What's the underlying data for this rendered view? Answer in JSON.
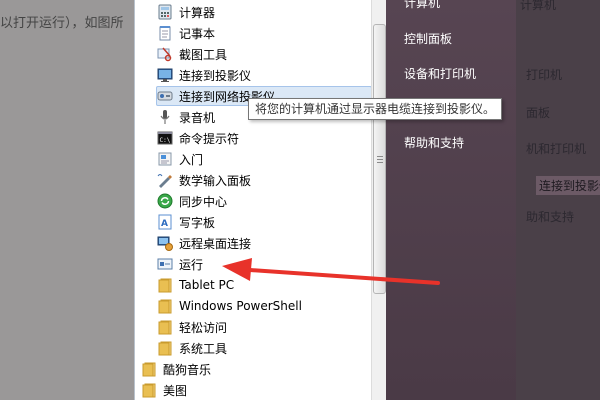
{
  "background": {
    "left_fragment": "以打开运行），如图所",
    "right_fragments": [
      "计算机",
      "打印机",
      "面板",
      "机和打印机",
      "连接到投影仪",
      "助和支持"
    ]
  },
  "menu": {
    "items": [
      {
        "label": "计算器",
        "icon": "calculator-icon"
      },
      {
        "label": "记事本",
        "icon": "notepad-icon"
      },
      {
        "label": "截图工具",
        "icon": "snipping-tool-icon"
      },
      {
        "label": "连接到投影仪",
        "icon": "projector-icon"
      },
      {
        "label": "连接到网络投影仪",
        "icon": "network-projector-icon"
      },
      {
        "label": "录音机",
        "icon": "microphone-icon"
      },
      {
        "label": "命令提示符",
        "icon": "command-prompt-icon"
      },
      {
        "label": "入门",
        "icon": "getting-started-icon"
      },
      {
        "label": "数学输入面板",
        "icon": "math-input-icon"
      },
      {
        "label": "同步中心",
        "icon": "sync-center-icon"
      },
      {
        "label": "写字板",
        "icon": "wordpad-icon"
      },
      {
        "label": "远程桌面连接",
        "icon": "remote-desktop-icon"
      },
      {
        "label": "运行",
        "icon": "run-icon"
      },
      {
        "label": "Tablet PC",
        "icon": "folder-icon"
      },
      {
        "label": "Windows PowerShell",
        "icon": "folder-icon"
      },
      {
        "label": "轻松访问",
        "icon": "folder-icon"
      },
      {
        "label": "系统工具",
        "icon": "folder-icon"
      },
      {
        "label": "酷狗音乐",
        "icon": "folder-icon"
      },
      {
        "label": "美图",
        "icon": "folder-icon"
      }
    ]
  },
  "right_panel": {
    "items": [
      "计算机",
      "控制面板",
      "设备和打印机",
      "帮助和支持"
    ]
  },
  "tooltip": {
    "text": "将您的计算机通过显示器电缆连接到投影仪。"
  },
  "colors": {
    "annotation_arrow": "#e8322a",
    "hover_bg": "#dbe8f6",
    "panel_bg": "#574552"
  }
}
